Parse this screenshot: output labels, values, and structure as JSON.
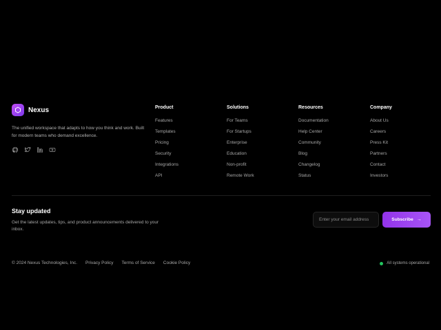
{
  "brand": {
    "name": "Nexus",
    "tagline": "The unified workspace that adapts to how you think and work. Built for modern teams who demand excellence.",
    "socials": [
      "github-icon",
      "twitter-icon",
      "linkedin-icon",
      "youtube-icon"
    ]
  },
  "columns": [
    {
      "title": "Product",
      "links": [
        "Features",
        "Templates",
        "Pricing",
        "Security",
        "Integrations",
        "API"
      ]
    },
    {
      "title": "Solutions",
      "links": [
        "For Teams",
        "For Startups",
        "Enterprise",
        "Education",
        "Non-profit",
        "Remote Work"
      ]
    },
    {
      "title": "Resources",
      "links": [
        "Documentation",
        "Help Center",
        "Community",
        "Blog",
        "Changelog",
        "Status"
      ]
    },
    {
      "title": "Company",
      "links": [
        "About Us",
        "Careers",
        "Press Kit",
        "Partners",
        "Contact",
        "Investors"
      ]
    }
  ],
  "newsletter": {
    "title": "Stay updated",
    "description": "Get the latest updates, tips, and product announcements delivered to your inbox.",
    "placeholder": "Enter your email address",
    "button_label": "Subscribe",
    "button_icon": "→"
  },
  "bottom": {
    "copyright": "© 2024 Nexus Technologies, Inc.",
    "legal": [
      "Privacy Policy",
      "Terms of Service",
      "Cookie Policy"
    ],
    "status": "All systems operational"
  },
  "colors": {
    "background": "#000000",
    "accent": "#a855f7",
    "status_ok": "#22c55e"
  }
}
